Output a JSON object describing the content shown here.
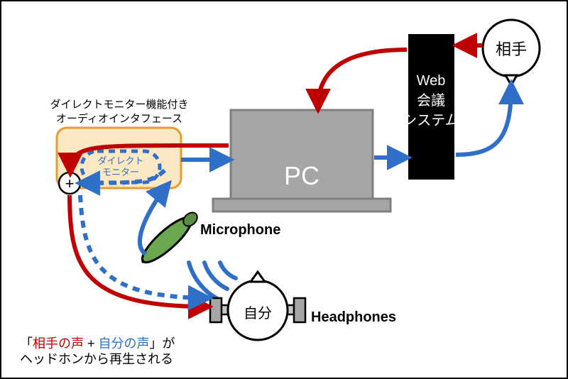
{
  "colors": {
    "red": "#c00000",
    "blue": "#2f6fc7",
    "black": "#000000",
    "pc_fill": "#a6a6a6",
    "pc_stroke": "#7f7f7f",
    "iface_fill": "#fde8c4",
    "iface_stroke": "#eb9b2d",
    "mic_fill": "#6aa84f",
    "headphone_fill": "#c8c8c8"
  },
  "nodes": {
    "interface_caption1": "ダイレクトモニター機能付き",
    "interface_caption2": "オーディオインタフェース",
    "direct_monitor1": "ダイレクト",
    "direct_monitor2": "モニター",
    "plus": "+",
    "pc": "PC",
    "web_sys1": "Web",
    "web_sys2": "会議",
    "web_sys3": "システム",
    "peer": "相手",
    "self": "自分",
    "microphone": "Microphone",
    "headphones": "Headphones"
  },
  "caption": {
    "pre": "「",
    "red": "相手の声",
    "plus": " + ",
    "blue": "自分の声",
    "post1": "」が",
    "line2": "ヘッドホンから再生される"
  }
}
